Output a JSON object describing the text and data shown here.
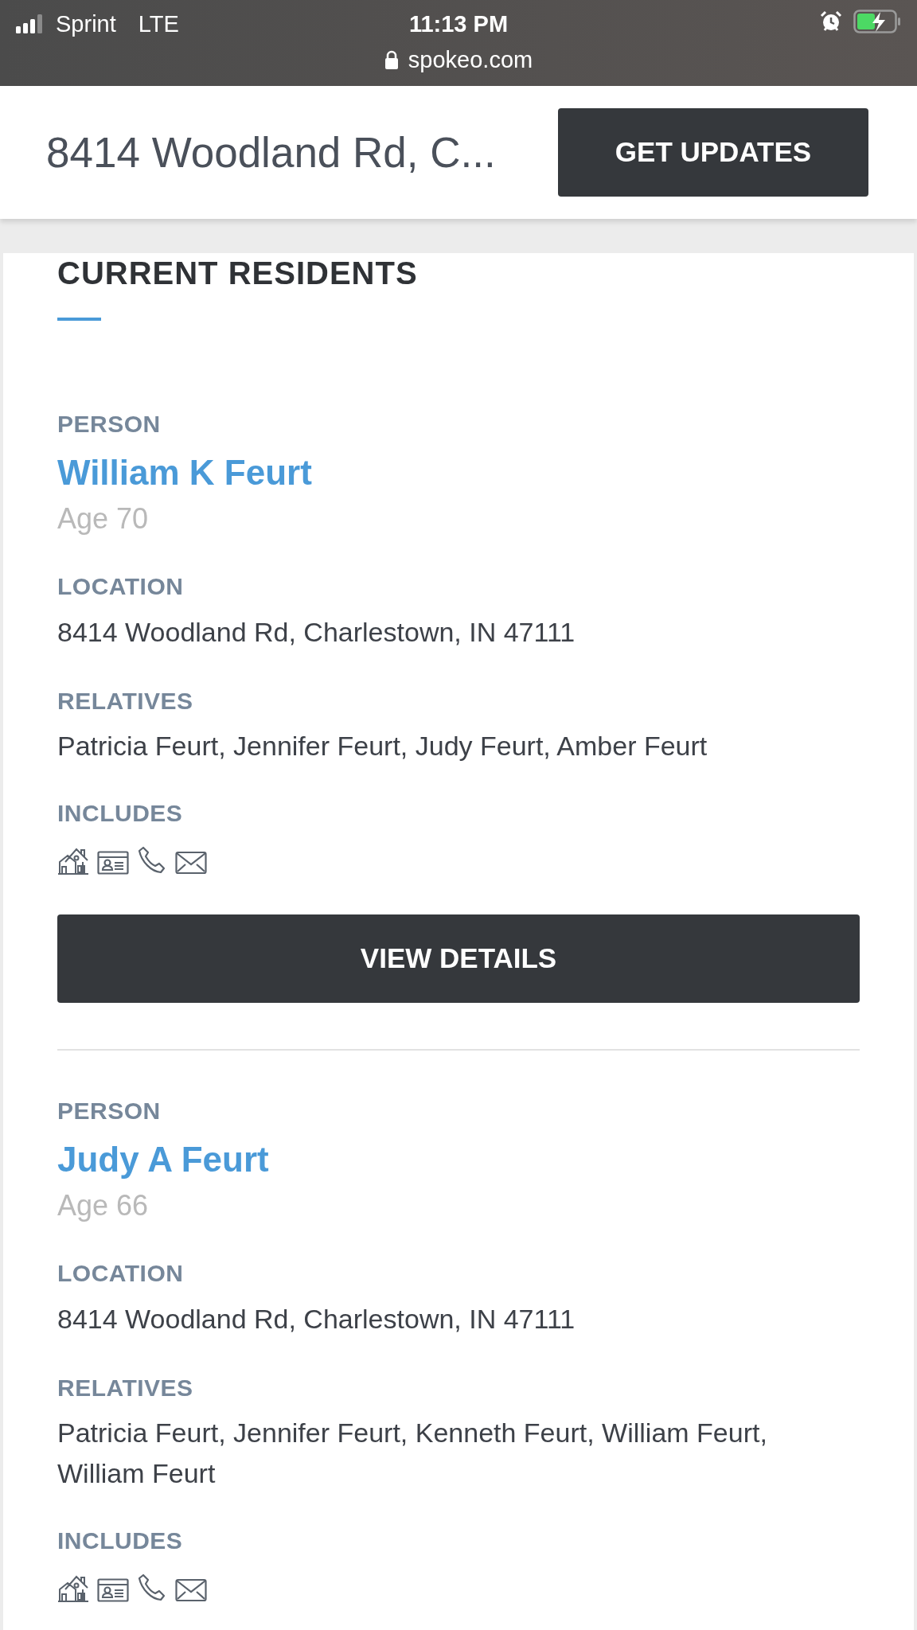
{
  "status_bar": {
    "carrier": "Sprint",
    "network": "LTE",
    "time": "11:13 PM",
    "url": "spokeo.com"
  },
  "header": {
    "title": "8414 Woodland Rd, C...",
    "button": "GET UPDATES"
  },
  "section_title": "CURRENT RESIDENTS",
  "residents": [
    {
      "person_label": "PERSON",
      "name": "William K Feurt",
      "age": "Age 70",
      "location_label": "LOCATION",
      "location": "8414 Woodland Rd, Charlestown, IN 47111",
      "relatives_label": "RELATIVES",
      "relatives": "Patricia Feurt, Jennifer Feurt, Judy Feurt, Amber Feurt",
      "includes_label": "INCLUDES",
      "button": "VIEW DETAILS"
    },
    {
      "person_label": "PERSON",
      "name": "Judy A Feurt",
      "age": "Age 66",
      "location_label": "LOCATION",
      "location": "8414 Woodland Rd, Charlestown, IN 47111",
      "relatives_label": "RELATIVES",
      "relatives": "Patricia Feurt, Jennifer Feurt, Kenneth Feurt, William Feurt, William Feurt",
      "includes_label": "INCLUDES"
    }
  ]
}
